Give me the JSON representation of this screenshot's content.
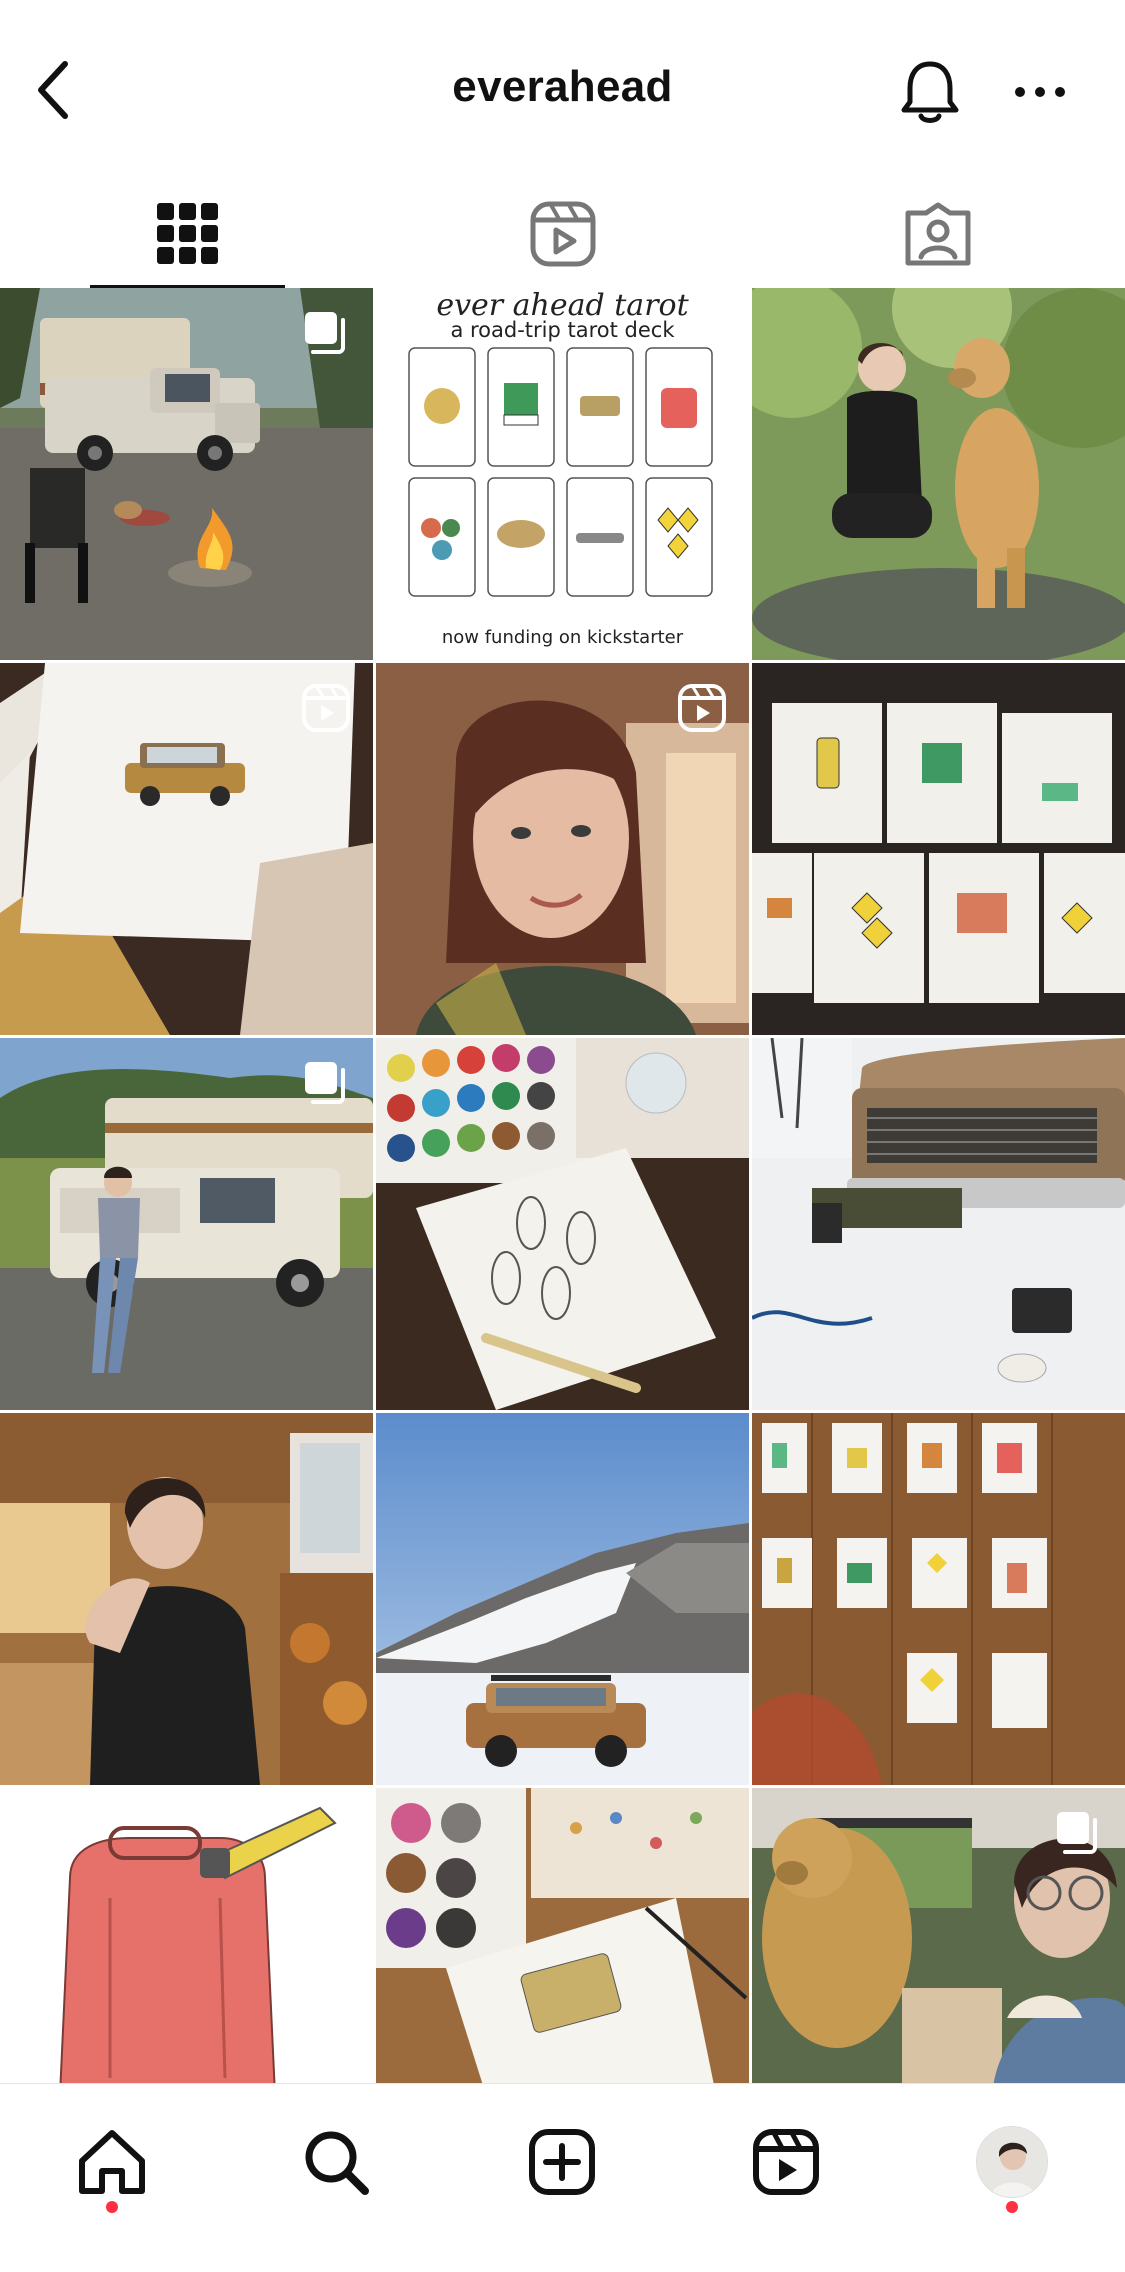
{
  "header": {
    "username": "everahead",
    "back_icon": "chevron-left-icon",
    "notification_icon": "bell-icon",
    "more_icon": "more-horizontal-icon"
  },
  "tabs": [
    {
      "name": "posts",
      "icon": "grid-icon",
      "active": true
    },
    {
      "name": "reels",
      "icon": "reels-icon",
      "active": false
    },
    {
      "name": "tagged",
      "icon": "tagged-icon",
      "active": false
    }
  ],
  "posts": [
    {
      "id": "post-1",
      "subject": "camper-truck-campfire",
      "badge": "carousel-icon"
    },
    {
      "id": "post-2",
      "subject": "tarot-poster",
      "badge": null,
      "title": "ever ahead tarot",
      "subtitle": "a road-trip tarot deck",
      "footer": "now funding on kickstarter"
    },
    {
      "id": "post-3",
      "subject": "woman-with-dog",
      "badge": null
    },
    {
      "id": "post-4",
      "subject": "station-wagon-drawing",
      "badge": "reels-icon"
    },
    {
      "id": "post-5",
      "subject": "portrait-woman",
      "badge": "reels-icon"
    },
    {
      "id": "post-6",
      "subject": "road-sign-drawings",
      "badge": null
    },
    {
      "id": "post-7",
      "subject": "woman-leaning-on-truck",
      "badge": "carousel-icon"
    },
    {
      "id": "post-8",
      "subject": "watercolor-keychains",
      "badge": null
    },
    {
      "id": "post-9",
      "subject": "snow-truck-repair",
      "badge": null
    },
    {
      "id": "post-10",
      "subject": "woman-in-camper",
      "badge": null
    },
    {
      "id": "post-11",
      "subject": "wagon-snowy-mountain",
      "badge": null
    },
    {
      "id": "post-12",
      "subject": "drawings-on-wall",
      "badge": null
    },
    {
      "id": "post-13",
      "subject": "red-gas-can-drawing",
      "badge": null
    },
    {
      "id": "post-14",
      "subject": "watercolor-wallet",
      "badge": null
    },
    {
      "id": "post-15",
      "subject": "dog-and-woman-in-car",
      "badge": "carousel-icon"
    }
  ],
  "bottom_nav": [
    {
      "name": "home",
      "icon": "home-icon",
      "notification_dot": true
    },
    {
      "name": "search",
      "icon": "search-icon",
      "notification_dot": false
    },
    {
      "name": "create",
      "icon": "plus-square-icon",
      "notification_dot": false
    },
    {
      "name": "reels",
      "icon": "reels-icon",
      "notification_dot": false
    },
    {
      "name": "profile",
      "icon": "avatar",
      "notification_dot": true
    }
  ],
  "colors": {
    "notification_dot": "#ff3040",
    "tab_active": "#111111",
    "tab_inactive": "#737373"
  }
}
